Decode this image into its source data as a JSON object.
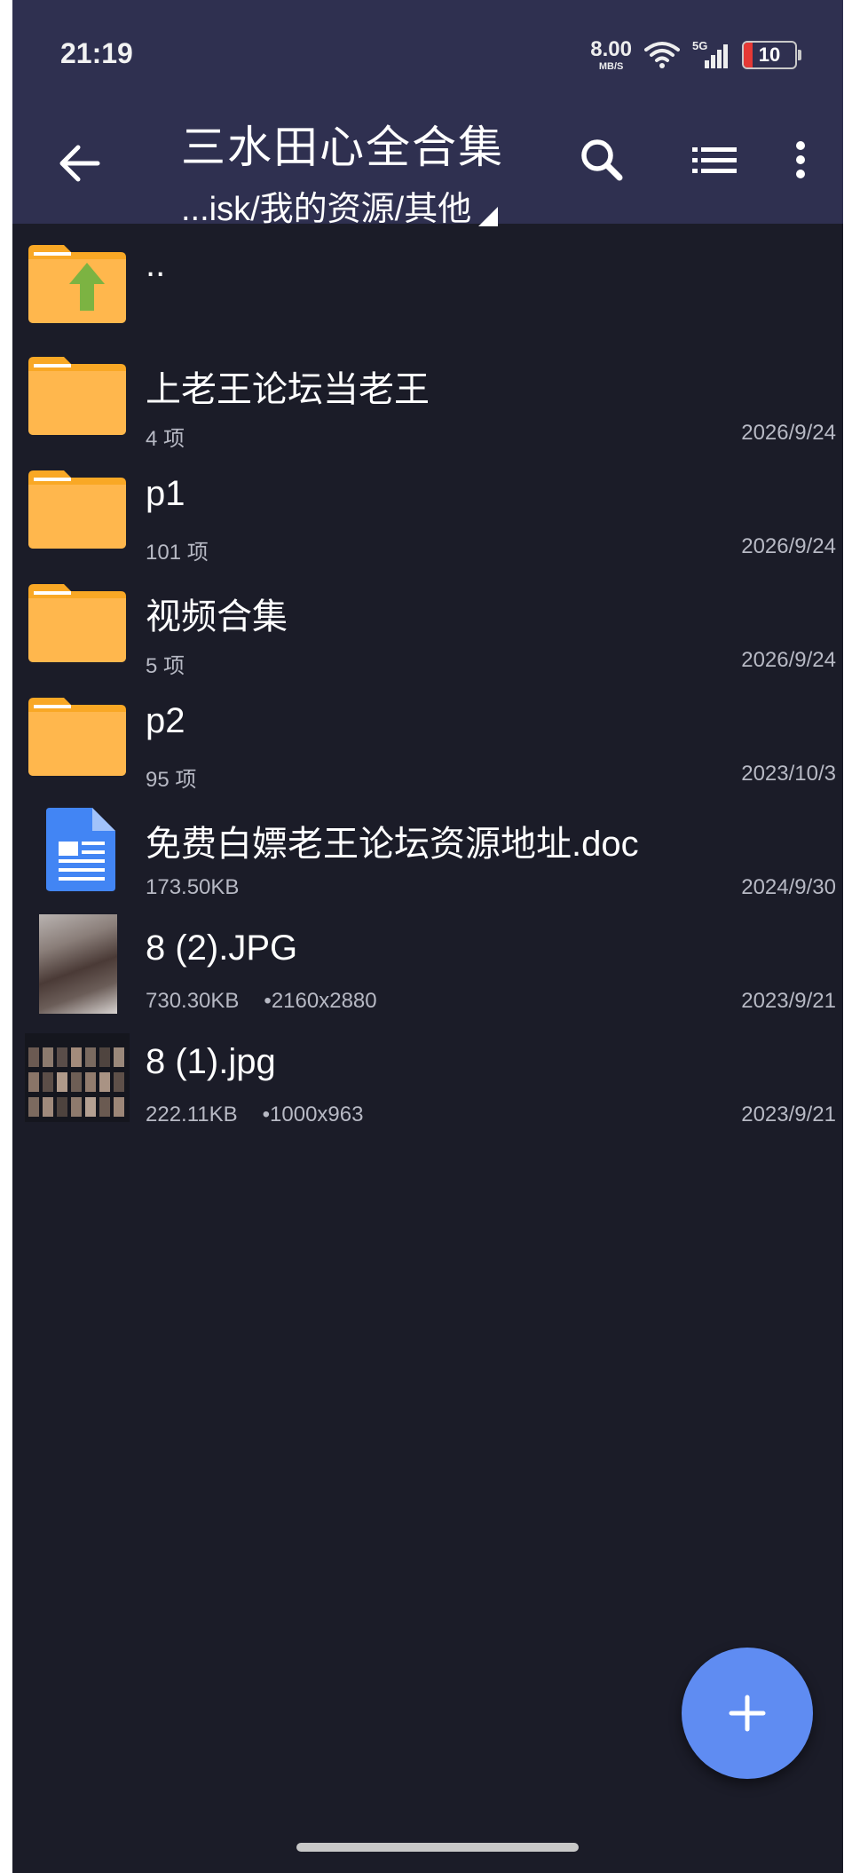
{
  "status_bar": {
    "time": "21:19",
    "net_speed_value": "8.00",
    "net_speed_unit": "MB/S",
    "network_type": "5G",
    "battery_level": "10",
    "icons": [
      "wifi-icon",
      "cellular-signal-icon",
      "battery-icon"
    ]
  },
  "toolbar": {
    "title": "三水田心全合集",
    "path": "...isk/我的资源/其他",
    "icons": [
      "back-arrow-icon",
      "search-icon",
      "list-view-icon",
      "more-vert-icon"
    ],
    "background": "#2f3050"
  },
  "files": {
    "parent": {
      "name": "..",
      "icon": "folder-up-icon"
    },
    "items": [
      {
        "name": "上老王论坛当老王",
        "meta": "4 项",
        "dim": "",
        "date": "2026/9/24",
        "icon": "folder-icon"
      },
      {
        "name": "p1",
        "meta": "101 项",
        "dim": "",
        "date": "2026/9/24",
        "icon": "folder-icon"
      },
      {
        "name": "视频合集",
        "meta": "5 项",
        "dim": "",
        "date": "2026/9/24",
        "icon": "folder-icon"
      },
      {
        "name": "p2",
        "meta": "95 项",
        "dim": "",
        "date": "2023/10/3",
        "icon": "folder-icon"
      },
      {
        "name": "免费白嫖老王论坛资源地址.doc",
        "meta": "173.50KB",
        "dim": "",
        "date": "2024/9/30",
        "icon": "doc-file-icon"
      },
      {
        "name": "8 (2).JPG",
        "meta": "730.30KB",
        "dim": "•2160x2880",
        "date": "2023/9/21",
        "icon": "image-thumbnail"
      },
      {
        "name": "8 (1).jpg",
        "meta": "222.11KB",
        "dim": "•1000x963",
        "date": "2023/9/21",
        "icon": "image-thumbnail"
      }
    ]
  },
  "fab": {
    "icon": "plus-icon",
    "color": "#5f8cf2"
  },
  "colors": {
    "background": "#1b1c28",
    "folder": "#f9a825",
    "doc": "#4285f4"
  }
}
